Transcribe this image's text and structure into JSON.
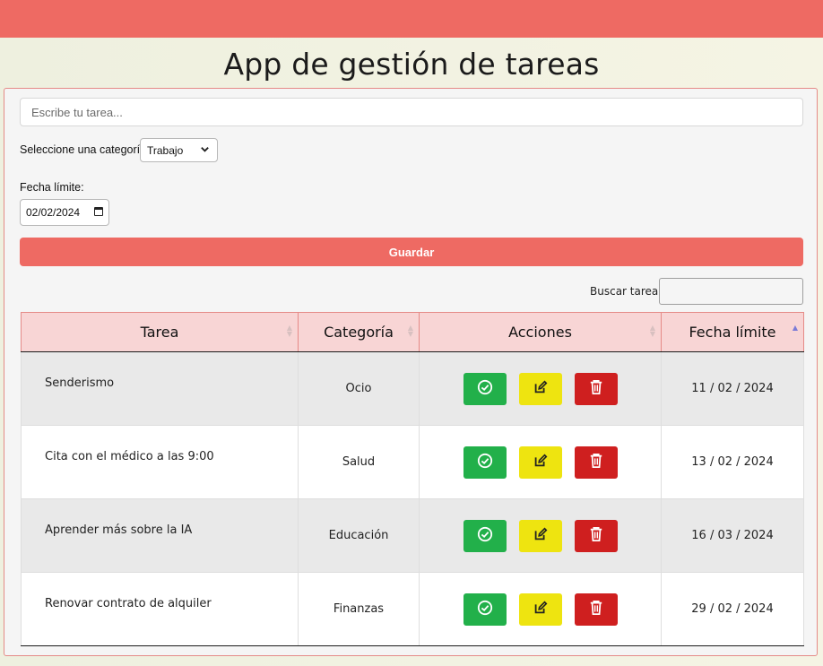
{
  "app": {
    "title": "App de gestión de tareas"
  },
  "form": {
    "task_placeholder": "Escribe tu tarea...",
    "category_label": "Seleccione una categoría",
    "category_selected": "Trabajo",
    "date_label": "Fecha límite:",
    "date_value": "02/02/2024",
    "save_label": "Guardar"
  },
  "search": {
    "label": "Buscar tarea:"
  },
  "table": {
    "columns": [
      "Tarea",
      "Categoría",
      "Acciones",
      "Fecha límite"
    ],
    "sorted_column": "Fecha límite",
    "rows": [
      {
        "task": "Senderismo",
        "category": "Ocio",
        "due": "11 / 02 / 2024"
      },
      {
        "task": "Cita con el médico a las 9:00",
        "category": "Salud",
        "due": "13 / 02 / 2024"
      },
      {
        "task": "Aprender más sobre la IA",
        "category": "Educación",
        "due": "16 / 03 / 2024"
      },
      {
        "task": "Renovar contrato de alquiler",
        "category": "Finanzas",
        "due": "29 / 02 / 2024"
      }
    ],
    "action_icons": [
      "check-circle-icon",
      "edit-icon",
      "trash-icon"
    ]
  },
  "colors": {
    "accent": "#ee6a63",
    "header_bg": "#f8d5d5",
    "complete": "#22b04a",
    "edit": "#eee410",
    "delete": "#cf1f1f"
  }
}
